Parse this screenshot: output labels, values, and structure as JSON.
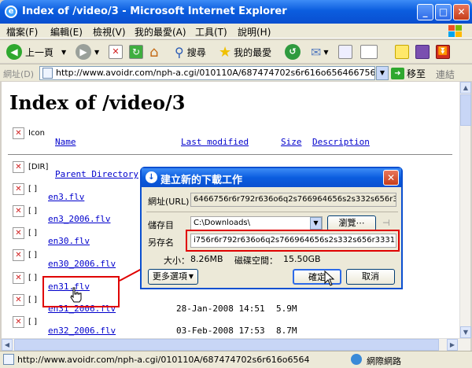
{
  "window": {
    "title": "Index of /video/3 - Microsoft Internet Explorer",
    "min": "_",
    "max": "□",
    "close": "✕"
  },
  "menu": [
    "檔案(F)",
    "編輯(E)",
    "檢視(V)",
    "我的最愛(A)",
    "工具(T)",
    "說明(H)"
  ],
  "toolbar": {
    "back": "上一頁",
    "search": "搜尋",
    "favorites": "我的最愛"
  },
  "address": {
    "label": "網址(D)",
    "url": "http://www.avoidr.com/nph-a.cgi/010110A/687474702s6r616o656466756r6r792r636",
    "go": "移至",
    "links": "連結"
  },
  "page": {
    "title": "Index of /video/3",
    "header_icon_alt": "Icon",
    "columns": {
      "name": "Name",
      "modified": "Last modified",
      "size": "Size",
      "description": "Description"
    },
    "parent": {
      "icon": "[DIR]",
      "name": "Parent Directory"
    },
    "rows": [
      {
        "icon": "[ ]",
        "name": "en3.flv",
        "modified": "",
        "size": ""
      },
      {
        "icon": "[ ]",
        "name": "en3_2006.flv",
        "modified": "",
        "size": ""
      },
      {
        "icon": "[ ]",
        "name": "en30.flv",
        "modified": "",
        "size": ""
      },
      {
        "icon": "[ ]",
        "name": "en30_2006.flv",
        "modified": "",
        "size": ""
      },
      {
        "icon": "[ ]",
        "name": "en31.flv",
        "modified": "",
        "size": ""
      },
      {
        "icon": "[ ]",
        "name": "en31_2006.flv",
        "modified": "28-Jan-2008 14:51",
        "size": "5.9M"
      },
      {
        "icon": "[ ]",
        "name": "en32_2006.flv",
        "modified": "03-Feb-2008 17:53",
        "size": "8.7M"
      }
    ]
  },
  "dialog": {
    "title": "建立新的下載工作",
    "url_label": "網址(URL)",
    "url_value": "6466756r6r792r636o6q2s766964656s2s332s656r33312r666p76",
    "save_label": "儲存目",
    "save_value": "C:\\Downloads\\",
    "browse": "瀏覽⋯",
    "saveas_label": "另存名",
    "saveas_value": "i756r6r792r636o6q2s766964656s2s332s656r33312r666p76.htm",
    "size_label": "大小：",
    "size_value": "8.26MB",
    "disk_label": "磁碟空間：",
    "disk_value": "15.50GB",
    "more": "更多選項",
    "ok": "確定",
    "cancel": "取消"
  },
  "status": {
    "text": "http://www.avoidr.com/nph-a.cgi/010110A/687474702s6r616o6564",
    "zone": "網際網路"
  },
  "colors": {
    "xp_blue": "#0a4fd0",
    "highlight_red": "#e00000",
    "link": "#0000cc"
  }
}
